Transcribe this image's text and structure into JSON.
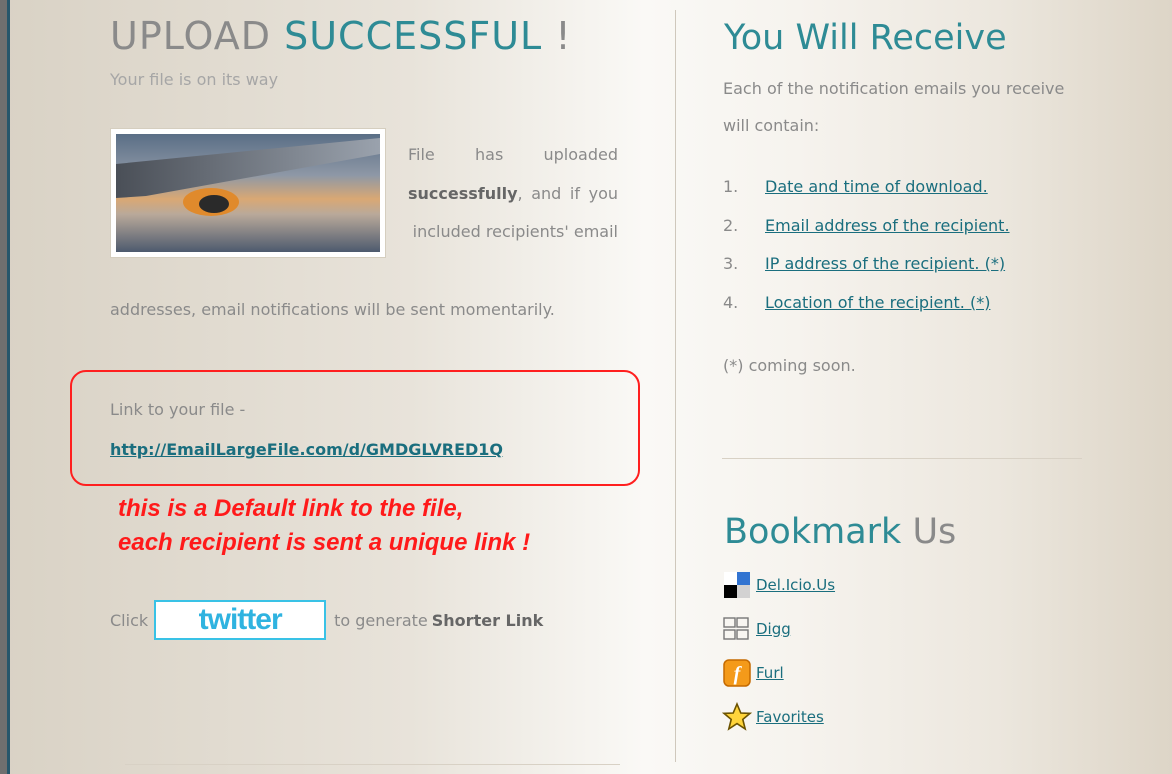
{
  "left": {
    "title_part1": "UPLOAD ",
    "title_part2": "SUCCESSFUL",
    "title_part3": " !",
    "subtitle": "Your file is on its way",
    "para1_a": "File has uploaded ",
    "para1_bold": "successfully",
    "para1_b": ", and if you included recipients' email",
    "para2": "addresses, email notifications will be sent momentarily.",
    "link_label": "Link to your file -",
    "file_link": "http://EmailLargeFile.com/d/GMDGLVRED1Q",
    "note_line1": "this is a Default link to the file,",
    "note_line2": "each recipient is sent a unique link !",
    "click_label": "Click",
    "twitter_label": "twitter",
    "generate_text": "to generate",
    "shorter_link": "Shorter Link"
  },
  "right": {
    "title": "You Will Receive",
    "desc": "Each of the notification emails you receive will contain:",
    "items": [
      {
        "num": "1.",
        "label": "Date and time of download."
      },
      {
        "num": "2.",
        "label": "Email address of the recipient."
      },
      {
        "num": "3.",
        "label": "IP address of the recipient. (*)"
      },
      {
        "num": "4.",
        "label": "Location of the recipient. (*)"
      }
    ],
    "note": "(*) coming soon.",
    "bookmark_title_1": "Bookmark",
    "bookmark_title_2": " Us",
    "bookmarks": [
      {
        "label": "Del.Icio.Us",
        "icon": "delicious-icon"
      },
      {
        "label": "Digg",
        "icon": "digg-icon"
      },
      {
        "label": "Furl",
        "icon": "furl-icon"
      },
      {
        "label": "Favorites",
        "icon": "star-icon"
      }
    ]
  },
  "colors": {
    "accent": "#2e8b95",
    "link": "#1a6e7e",
    "highlight": "#ff1a1a",
    "twitter": "#2fb3e0"
  }
}
